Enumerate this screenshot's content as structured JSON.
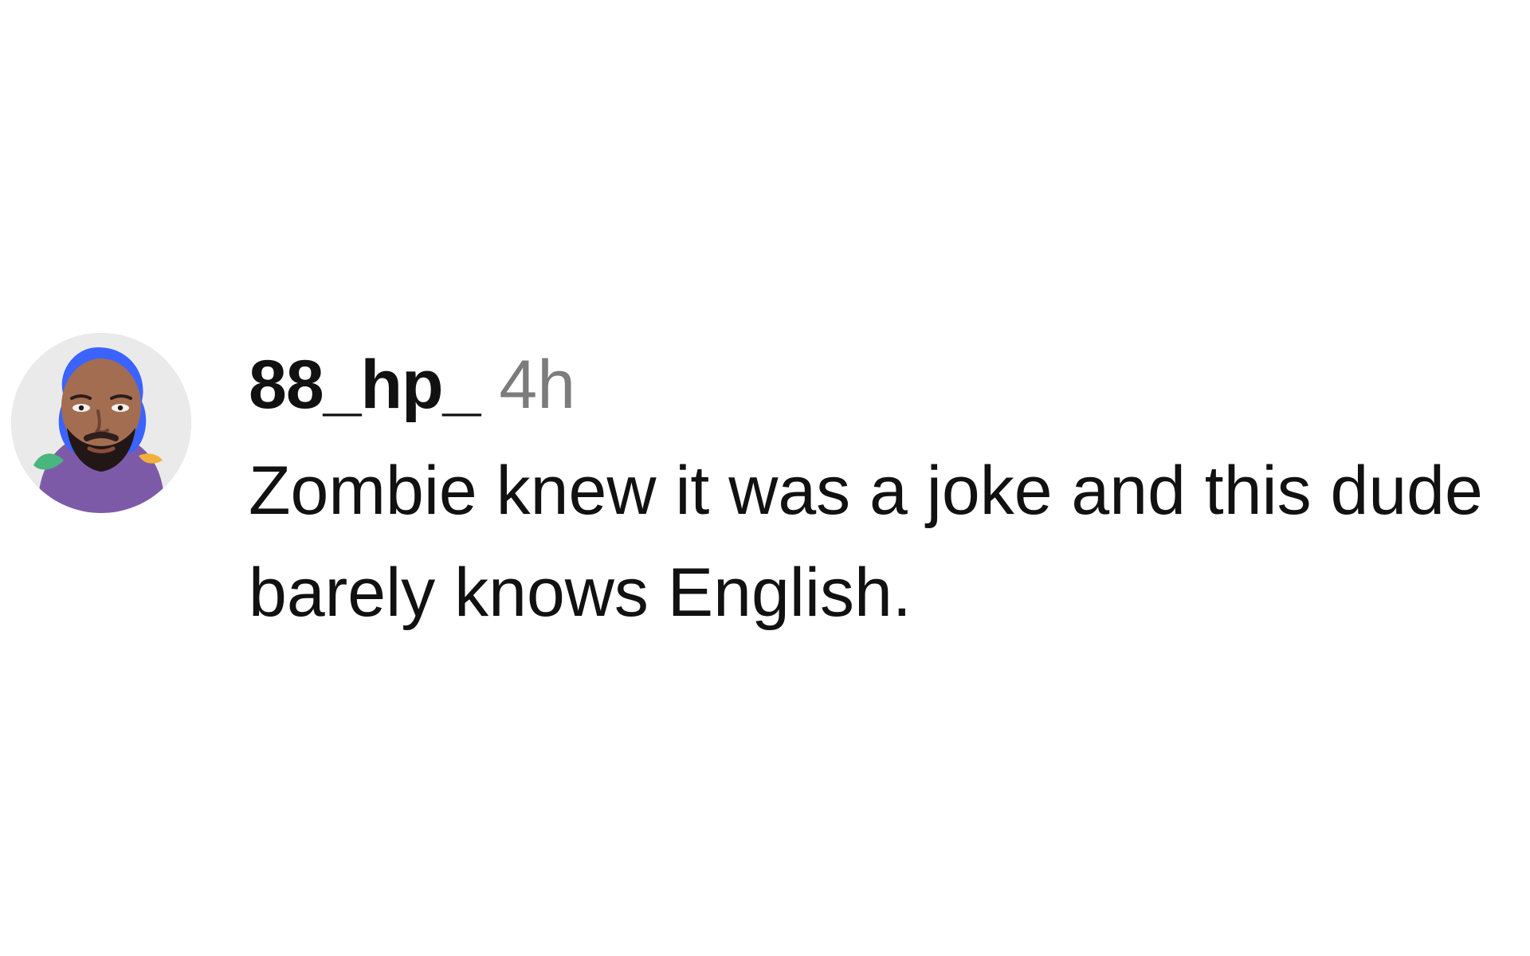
{
  "comment": {
    "username": "88_hp_",
    "time": "4h",
    "text": "Zombie knew it was a joke and this dude barely knows English.",
    "avatar": {
      "icon": "user-avatar-icon",
      "background": "#eaeaea",
      "skin": "#a36d52",
      "hair": "#3b63ff",
      "shirt": "#7d5aa8"
    }
  }
}
